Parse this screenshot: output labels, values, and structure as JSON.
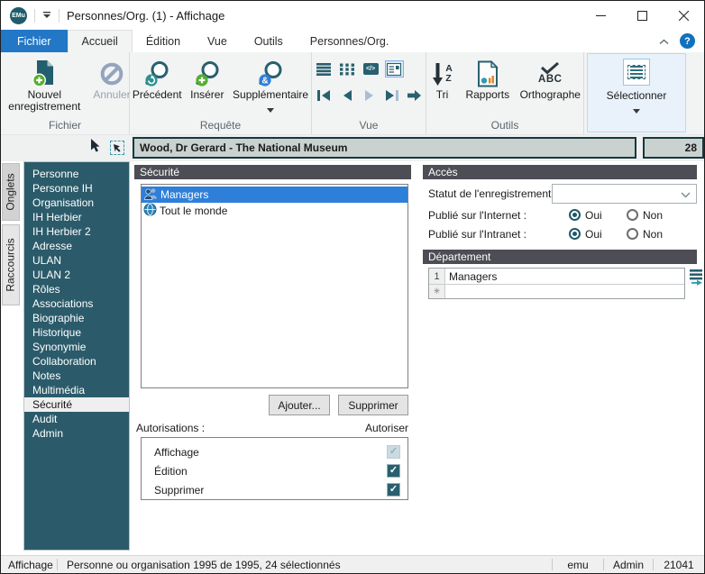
{
  "titlebar": {
    "title": "Personnes/Org. (1) - Affichage"
  },
  "tabs": {
    "fichier": "Fichier",
    "accueil": "Accueil",
    "edition": "Édition",
    "vue": "Vue",
    "outils": "Outils",
    "contextual": "Personnes/Org."
  },
  "ribbon": {
    "fichier": {
      "label": "Fichier",
      "new_record": "Nouvel enregistrement",
      "cancel": "Annuler"
    },
    "requete": {
      "label": "Requête",
      "previous": "Précédent",
      "insert": "Insérer",
      "additional": "Supplémentaire"
    },
    "vue": {
      "label": "Vue"
    },
    "outils": {
      "label": "Outils",
      "sort": "Tri",
      "reports": "Rapports",
      "spelling": "Orthographe"
    },
    "select": {
      "label": "Sélectionner"
    }
  },
  "record_header": {
    "title": "Wood, Dr Gerard - The National Museum",
    "number": "28"
  },
  "side_tabs": {
    "onglets": "Onglets",
    "raccourcis": "Raccourcis"
  },
  "sidebar": {
    "items": [
      "Personne",
      "Personne IH",
      "Organisation",
      "IH Herbier",
      "IH Herbier 2",
      "Adresse",
      "ULAN",
      "ULAN 2",
      "Rôles",
      "Associations",
      "Biographie",
      "Historique",
      "Synonymie",
      "Collaboration",
      "Notes",
      "Multimédia",
      "Sécurité",
      "Audit",
      "Admin"
    ],
    "selected_item": "Sécurité"
  },
  "security": {
    "header": "Sécurité",
    "groups": [
      {
        "name": "Managers"
      },
      {
        "name": "Tout le monde"
      }
    ],
    "selected_group": "Managers",
    "add_button": "Ajouter...",
    "delete_button": "Supprimer",
    "permissions_label": "Autorisations :",
    "allow_column": "Autoriser",
    "permissions": [
      {
        "name": "Affichage",
        "checked": true,
        "disabled": true
      },
      {
        "name": "Édition",
        "checked": true,
        "disabled": false
      },
      {
        "name": "Supprimer",
        "checked": true,
        "disabled": false
      }
    ]
  },
  "access": {
    "header": "Accès",
    "record_status_label": "Statut de l'enregistrement :",
    "record_status_value": "",
    "internet_label": "Publié sur l'Internet :",
    "intranet_label": "Publié sur l'Intranet :",
    "yes_label": "Oui",
    "no_label": "Non",
    "internet_value": "Oui",
    "intranet_value": "Oui"
  },
  "department": {
    "header": "Département",
    "rows": [
      {
        "row_number": "1",
        "value": "Managers"
      }
    ],
    "new_row_marker": "✳"
  },
  "statusbar": {
    "mode": "Affichage",
    "record_info": "Personne ou organisation 1995 de 1995, 24 sélectionnés",
    "database": "emu",
    "user": "Admin",
    "port": "21041"
  },
  "icons": {
    "logo_text": "EMu",
    "help": "?",
    "code_view": "</>",
    "ampersand_badge": "&",
    "sort_a": "A",
    "sort_z": "Z",
    "abc": "ABC",
    "check": "✓"
  },
  "colors": {
    "accent_teal": "#28606F",
    "sidebar_teal": "#2B5B6A",
    "selection_blue": "#2E7FD9",
    "tab_blue": "#2277C6",
    "group_header_gray": "#4C4D55",
    "record_header_bg": "#C9D2CE"
  }
}
